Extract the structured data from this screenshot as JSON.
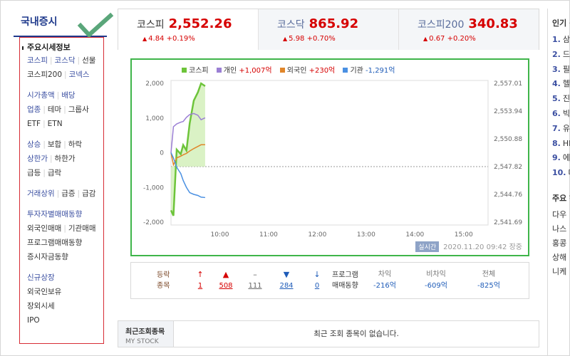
{
  "sidebar": {
    "title": "국내증시",
    "section_title": "주요시세정보",
    "rows": [
      [
        {
          "t": "코스피",
          "c": "blue"
        },
        {
          "t": "코스닥",
          "c": "blue"
        },
        {
          "t": "선물",
          "c": ""
        }
      ],
      [
        {
          "t": "코스피200",
          "c": ""
        },
        {
          "t": "코넥스",
          "c": "blue"
        }
      ],
      "gap",
      [
        {
          "t": "시가총액",
          "c": "blue"
        },
        {
          "t": "배당",
          "c": "blue"
        }
      ],
      [
        {
          "t": "업종",
          "c": "blue"
        },
        {
          "t": "테마",
          "c": ""
        },
        {
          "t": "그룹사",
          "c": ""
        }
      ],
      [
        {
          "t": "ETF",
          "c": ""
        },
        {
          "t": "ETN",
          "c": ""
        }
      ],
      "gap",
      [
        {
          "t": "상승",
          "c": "blue"
        },
        {
          "t": "보합",
          "c": ""
        },
        {
          "t": "하락",
          "c": ""
        }
      ],
      [
        {
          "t": "상한가",
          "c": "blue"
        },
        {
          "t": "하한가",
          "c": ""
        }
      ],
      [
        {
          "t": "급등",
          "c": ""
        },
        {
          "t": "급락",
          "c": ""
        }
      ],
      "gap",
      [
        {
          "t": "거래상위",
          "c": "blue"
        },
        {
          "t": "급증",
          "c": ""
        },
        {
          "t": "급감",
          "c": ""
        }
      ],
      "gap",
      [
        {
          "t": "투자자별매매동향",
          "c": "blue"
        }
      ],
      [
        {
          "t": "외국인매매",
          "c": ""
        },
        {
          "t": "기관매매",
          "c": ""
        }
      ],
      [
        {
          "t": "프로그램매매동향",
          "c": ""
        }
      ],
      [
        {
          "t": "증시자금동향",
          "c": ""
        }
      ],
      "gap",
      [
        {
          "t": "신규상장",
          "c": "blue"
        }
      ],
      [
        {
          "t": "외국인보유",
          "c": ""
        }
      ],
      [
        {
          "t": "장외시세",
          "c": ""
        }
      ],
      [
        {
          "t": "IPO",
          "c": ""
        }
      ]
    ]
  },
  "tabs": [
    {
      "name": "코스피",
      "value": "2,552.26",
      "change": "4.84 +0.19%",
      "active": true
    },
    {
      "name": "코스닥",
      "value": "865.92",
      "change": "5.98 +0.70%",
      "active": false
    },
    {
      "name": "코스피200",
      "value": "340.83",
      "change": "0.67 +0.20%",
      "active": false
    }
  ],
  "legend": {
    "kospi": "코스피",
    "individual": {
      "label": "개인",
      "value": "+1,007억"
    },
    "foreign": {
      "label": "외국인",
      "value": "+230억"
    },
    "institution": {
      "label": "기관",
      "value": "-1,291억"
    }
  },
  "colors": {
    "kospi": "#6dc43a",
    "individual": "#9b7fd4",
    "foreign": "#e0862a",
    "institution": "#4a90e2",
    "accent_red": "#d60000",
    "accent_blue": "#1f5cb8",
    "highlight_box": "#3fb54a",
    "sidebar_box": "#d72c35"
  },
  "chart_data": {
    "type": "line",
    "x_ticks": [
      "10:00",
      "11:00",
      "12:00",
      "13:00",
      "14:00",
      "15:00"
    ],
    "x_range": [
      "09:00",
      "15:30"
    ],
    "y_left_ticks": [
      "2,000",
      "1,000",
      "0",
      "-1,000",
      "-2,000"
    ],
    "y_left_range": [
      -2000,
      2000
    ],
    "y_right_ticks": [
      "2,557.01",
      "2,553.94",
      "2,550.88",
      "2,547.82",
      "2,544.76",
      "2,541.69"
    ],
    "y_right_range": [
      2541.69,
      2557.01
    ],
    "baseline": 2547.82,
    "series": [
      {
        "name": "코스피",
        "axis": "right",
        "x": [
          "09:00",
          "09:03",
          "09:07",
          "09:12",
          "09:15",
          "09:19",
          "09:23",
          "09:28",
          "09:33",
          "09:37",
          "09:42"
        ],
        "y": [
          2543.0,
          2542.4,
          2549.7,
          2549.2,
          2550.2,
          2549.6,
          2552.6,
          2555.1,
          2556.0,
          2557.0,
          2556.7
        ]
      },
      {
        "name": "개인",
        "axis": "left",
        "x": [
          "09:00",
          "09:03",
          "09:07",
          "09:12",
          "09:15",
          "09:19",
          "09:23",
          "09:28",
          "09:33",
          "09:37",
          "09:42"
        ],
        "y": [
          0,
          750,
          830,
          880,
          900,
          1020,
          1100,
          1130,
          1080,
          950,
          1007
        ]
      },
      {
        "name": "외국인",
        "axis": "left",
        "x": [
          "09:00",
          "09:03",
          "09:07",
          "09:12",
          "09:15",
          "09:19",
          "09:23",
          "09:28",
          "09:33",
          "09:37",
          "09:42"
        ],
        "y": [
          0,
          -350,
          -150,
          -100,
          -60,
          -20,
          50,
          120,
          180,
          230,
          230
        ]
      },
      {
        "name": "기관",
        "axis": "left",
        "x": [
          "09:00",
          "09:03",
          "09:07",
          "09:12",
          "09:15",
          "09:19",
          "09:23",
          "09:28",
          "09:33",
          "09:37",
          "09:42"
        ],
        "y": [
          0,
          -150,
          -420,
          -600,
          -800,
          -1000,
          -1150,
          -1200,
          -1230,
          -1280,
          -1291
        ]
      }
    ]
  },
  "status": {
    "live": "실시간",
    "time": "2020.11.20 09:42",
    "state": "장중"
  },
  "stats": {
    "label1": "등락",
    "label2": "종목",
    "items": [
      {
        "icon": "↑",
        "value": "1",
        "color": "red",
        "name": "upper-limit"
      },
      {
        "icon": "▲",
        "value": "508",
        "color": "red",
        "name": "rise"
      },
      {
        "icon": "–",
        "value": "111",
        "color": "gray",
        "name": "flat"
      },
      {
        "icon": "▼",
        "value": "284",
        "color": "blue",
        "name": "fall"
      },
      {
        "icon": "↓",
        "value": "0",
        "color": "blue",
        "name": "lower-limit"
      }
    ],
    "program_label1": "프로그램",
    "program_label2": "매매동향",
    "program": [
      {
        "head": "차익",
        "value": "-216억"
      },
      {
        "head": "비차익",
        "value": "-609억"
      },
      {
        "head": "전체",
        "value": "-825억"
      }
    ]
  },
  "recent": {
    "title": "최근조회종목",
    "subtitle": "MY STOCK",
    "empty": "최근 조회 종목이 없습니다."
  },
  "right": {
    "title": "인기 검",
    "items": [
      {
        "n": "1.",
        "t": "삼"
      },
      {
        "n": "2.",
        "t": "드"
      },
      {
        "n": "3.",
        "t": "필"
      },
      {
        "n": "4.",
        "t": "헬"
      },
      {
        "n": "5.",
        "t": "진"
      },
      {
        "n": "6.",
        "t": "빅"
      },
      {
        "n": "7.",
        "t": "유"
      },
      {
        "n": "8.",
        "t": "HI"
      },
      {
        "n": "9.",
        "t": "에"
      },
      {
        "n": "10.",
        "t": "대"
      }
    ],
    "sub_title": "주요 해",
    "lines": [
      "다우",
      "나스",
      "홍콩",
      "상해",
      "니케"
    ]
  }
}
